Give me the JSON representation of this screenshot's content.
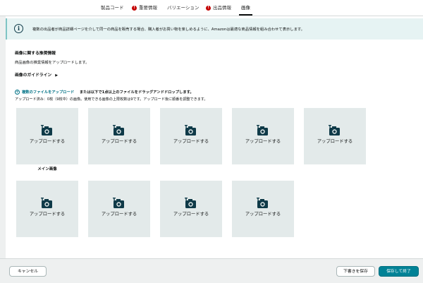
{
  "tabs": [
    {
      "label": "製品コード",
      "error": false,
      "active": false
    },
    {
      "label": "重要情報",
      "error": true,
      "active": false
    },
    {
      "label": "バリエーション",
      "error": false,
      "active": false
    },
    {
      "label": "出品情報",
      "error": true,
      "active": false
    },
    {
      "label": "画像",
      "error": false,
      "active": true
    }
  ],
  "error_badge": "!",
  "banner": {
    "icon": "info-icon",
    "text": "複数の出品者が商品詳細ページを介して同一の商品を販売する場合、購入者がお買い物を楽しめるように、Amazonは最適な商品情報を組み合わせて表示します。"
  },
  "images_section": {
    "heading": "画像に関する推奨情報",
    "description": "商品画像の推奨情報をアップロードします。",
    "guide_label": "画像のガイドライン",
    "guide_arrow": "▶",
    "add_files_icon": "+",
    "add_files_link": "複数のファイルをアップロード",
    "drop_text": "または以下で1点以上のファイルをドラッグアンドドロップします。",
    "status_text": "アップロード済み：0枚（9枚中）の画像。使用できる画像の上限枚数は9です。アップロード後に順番を調整できます。",
    "tile_icon": "camera-add-icon",
    "tiles": [
      {
        "label": "アップロードする"
      },
      {
        "label": "アップロードする"
      },
      {
        "label": "アップロードする"
      },
      {
        "label": "アップロードする"
      },
      {
        "label": "アップロードする"
      },
      {
        "label": "アップロードする"
      },
      {
        "label": "アップロードする"
      },
      {
        "label": "アップロードする"
      },
      {
        "label": "アップロードする"
      }
    ],
    "main_image_label": "メイン画像"
  },
  "footer": {
    "cancel_label": "キャンセル",
    "save_draft_label": "下書きを保存",
    "save_finish_label": "保存して終了"
  },
  "colors": {
    "accent": "#008296",
    "link": "#007185",
    "error": "#c40000",
    "banner_bg": "#e6f3f3",
    "tile_bg": "#e3eaea"
  }
}
